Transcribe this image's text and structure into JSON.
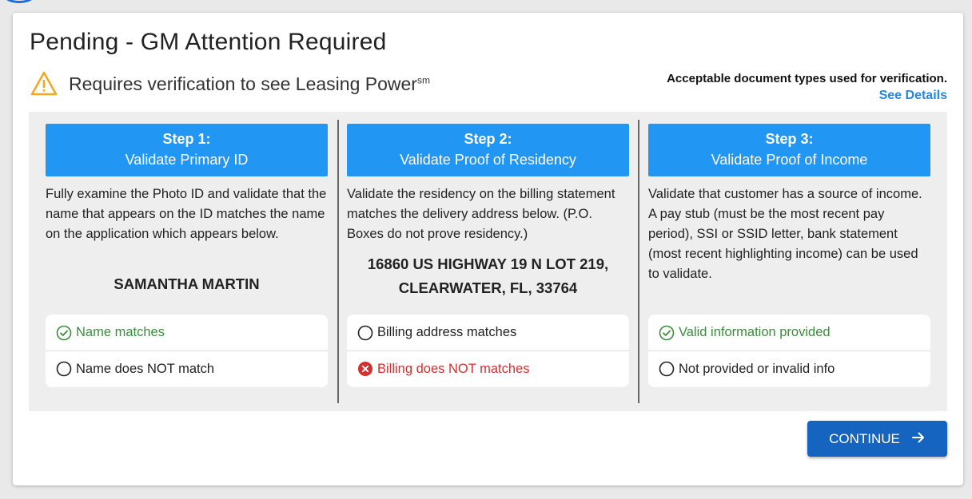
{
  "card": {
    "title": "Pending - GM Attention Required",
    "warning_text": "Requires verification to see Leasing Power",
    "warning_superscript": "sm",
    "doc_types_label": "Acceptable document types used for verification.",
    "see_details_link": "See Details"
  },
  "steps": [
    {
      "number": "Step 1:",
      "name": "Validate Primary ID",
      "description": "Fully examine the Photo ID and validate that the name that appears on the ID matches the name on the application which appears below.",
      "detail_line1": "SAMANTHA MARTIN",
      "detail_line2": "",
      "options": [
        {
          "label": "Name matches",
          "state": "checked-green"
        },
        {
          "label": "Name does NOT match",
          "state": "unchecked"
        }
      ]
    },
    {
      "number": "Step 2:",
      "name": "Validate Proof of Residency",
      "description": "Validate the residency on the billing statement matches the delivery address below. (P.O. Boxes do not prove residency.)",
      "detail_line1": "16860 US HIGHWAY 19 N LOT 219,",
      "detail_line2": "CLEARWATER, FL, 33764",
      "options": [
        {
          "label": "Billing address matches",
          "state": "unchecked"
        },
        {
          "label": "Billing does NOT matches",
          "state": "checked-red"
        }
      ]
    },
    {
      "number": "Step 3:",
      "name": "Validate Proof of Income",
      "description": "Validate that customer has a source of income. A pay stub (must be the most recent pay period), SSI or SSID letter, bank statement (most recent highlighting income) can be used to validate.",
      "detail_line1": "",
      "detail_line2": "",
      "options": [
        {
          "label": "Valid information provided",
          "state": "checked-green"
        },
        {
          "label": "Not provided or invalid info",
          "state": "unchecked"
        }
      ]
    }
  ],
  "continue_button": {
    "label": "CONTINUE"
  },
  "colors": {
    "step_header": "#2196f3",
    "continue_button": "#1565c0",
    "link": "#1e88e5",
    "success": "#3d8b3d",
    "error": "#d32f2f",
    "warning": "#f5a623"
  },
  "icons": {
    "warning": "warning-triangle-icon",
    "checked_green": "check-circle-icon",
    "checked_red": "error-circle-icon",
    "unchecked": "radio-empty-icon",
    "continue": "arrow-right-icon"
  }
}
